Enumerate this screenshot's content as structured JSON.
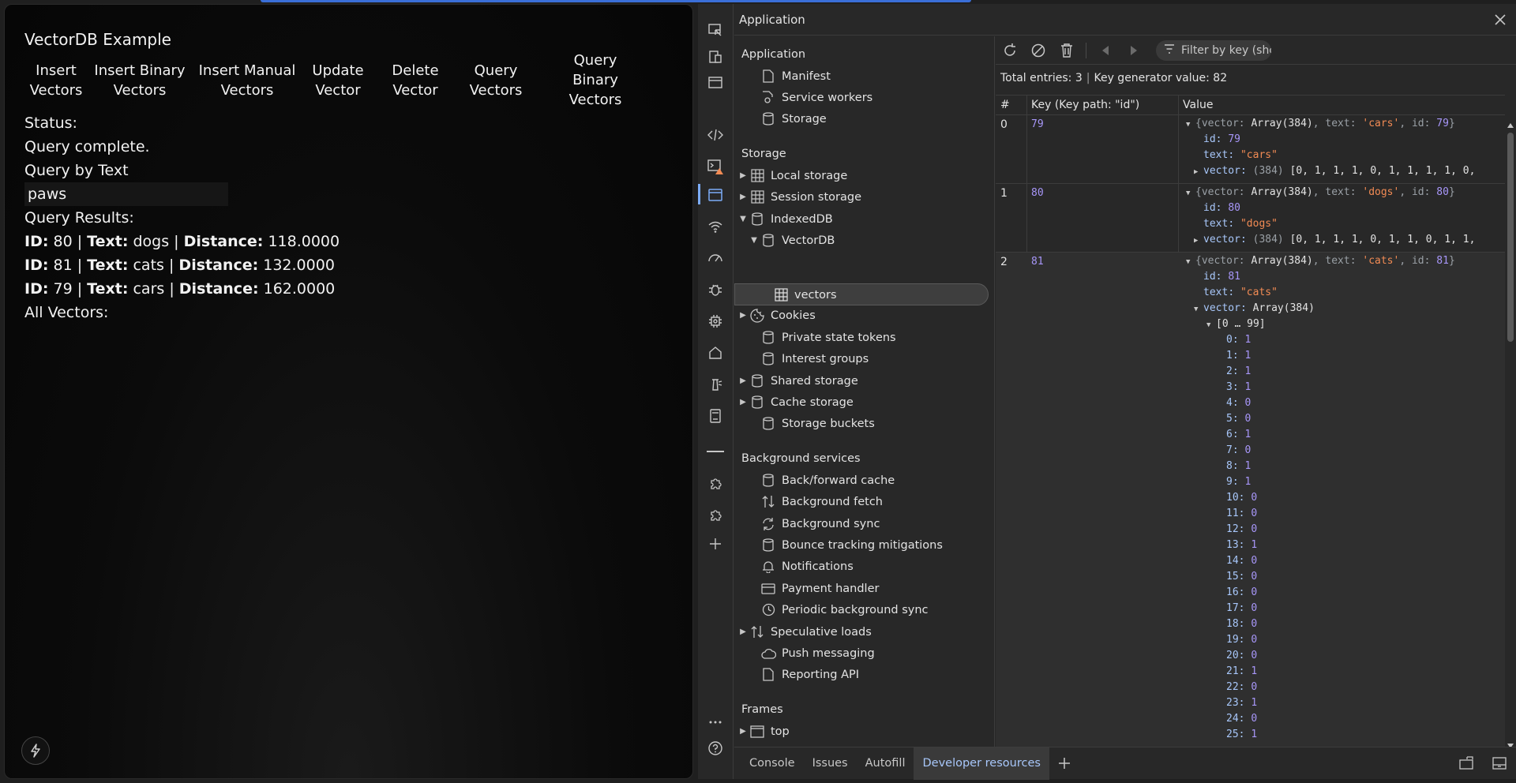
{
  "page": {
    "title": "VectorDB Example",
    "buttons": [
      {
        "label": "Insert Vectors"
      },
      {
        "label": "Insert Binary Vectors"
      },
      {
        "label": "Insert Manual Vectors"
      },
      {
        "label": "Update Vector"
      },
      {
        "label": "Delete Vector"
      },
      {
        "label": "Query Vectors"
      },
      {
        "label": "Query Binary Vectors"
      }
    ],
    "status_label": "Status:",
    "status_text": "Query complete.",
    "query_label": "Query by Text",
    "query_value": "paws",
    "results_label": "Query Results:",
    "id_label": "ID:",
    "text_label": "Text:",
    "distance_label": "Distance:",
    "results": [
      {
        "id": "80",
        "text": "dogs",
        "distance": "118.0000"
      },
      {
        "id": "81",
        "text": "cats",
        "distance": "132.0000"
      },
      {
        "id": "79",
        "text": "cars",
        "distance": "162.0000"
      }
    ],
    "all_vectors_label": "All Vectors:"
  },
  "devtools": {
    "panel_title": "Application",
    "sections": {
      "application": "Application",
      "storage": "Storage",
      "background": "Background services",
      "frames": "Frames"
    },
    "application_items": [
      "Manifest",
      "Service workers",
      "Storage"
    ],
    "storage_items": {
      "local": "Local storage",
      "session": "Session storage",
      "indexeddb": "IndexedDB",
      "db": "VectorDB",
      "store": "vectors",
      "cookies": "Cookies",
      "pst": "Private state tokens",
      "interest": "Interest groups",
      "shared": "Shared storage",
      "cache": "Cache storage",
      "buckets": "Storage buckets"
    },
    "background_items": [
      "Back/forward cache",
      "Background fetch",
      "Background sync",
      "Bounce tracking mitigations",
      "Notifications",
      "Payment handler",
      "Periodic background sync",
      "Speculative loads",
      "Push messaging",
      "Reporting API"
    ],
    "frames_items": [
      "top"
    ],
    "filter_placeholder": "Filter by key (sho",
    "total_entries": "Total entries: 3",
    "separator": "|",
    "key_generator": "Key generator value: 82",
    "columns": {
      "num": "#",
      "key": "Key (Key path: \"id\")",
      "value": "Value"
    },
    "rows": [
      {
        "num": "0",
        "key": "79",
        "text": "cars",
        "vector_preview": "[0, 1, 1, 1, 0, 1, 1, 1, 1, 0,"
      },
      {
        "num": "1",
        "key": "80",
        "text": "dogs",
        "vector_preview": "[0, 1, 1, 1, 0, 1, 1, 0, 1, 1,"
      },
      {
        "num": "2",
        "key": "81",
        "text": "cats"
      }
    ],
    "value_labels": {
      "vector_key": "vector",
      "text_key": "text",
      "id_key": "id",
      "array_summary": "Array(384)",
      "count_384": "(384)",
      "range_0_99": "[0 … 99]"
    },
    "expanded_vector": [
      1,
      1,
      1,
      1,
      0,
      0,
      1,
      0,
      1,
      1,
      0,
      0,
      0,
      1,
      0,
      0,
      0,
      0,
      0,
      0,
      0,
      1,
      0,
      1,
      0,
      1
    ],
    "drawer_tabs": [
      "Console",
      "Issues",
      "Autofill",
      "Developer resources"
    ],
    "active_drawer_tab": "Developer resources",
    "colors": {
      "accent": "#7cacf8",
      "key": "#a796f8",
      "string": "#f28b54",
      "warning": "#f28b54"
    }
  }
}
